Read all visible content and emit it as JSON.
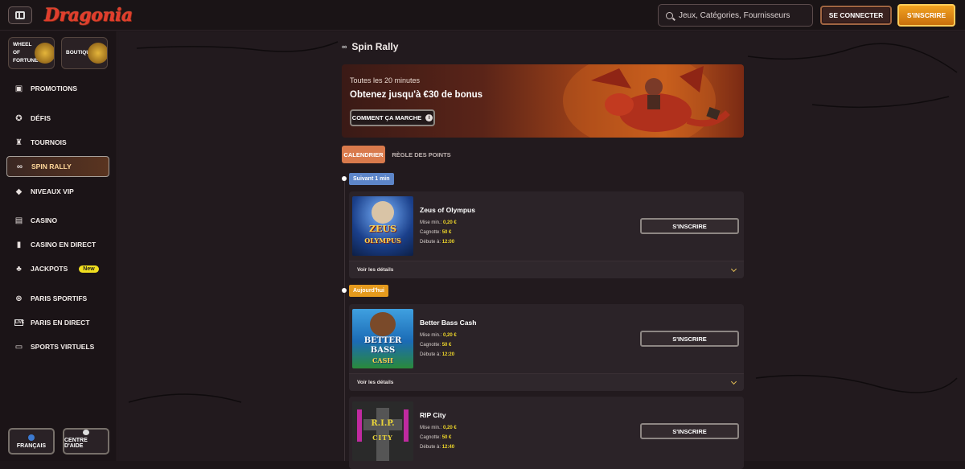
{
  "header": {
    "logo": "Dragonia",
    "search_placeholder": "Jeux, Catégories, Fournisseurs",
    "login_label": "SE CONNECTER",
    "signup_label": "S'INSCRIRE"
  },
  "sidebar": {
    "tiles": [
      {
        "label": "WHEEL OF FORTUNE"
      },
      {
        "label": "BOUTIQUE"
      }
    ],
    "items": [
      {
        "label": "PROMOTIONS",
        "icon": "gift-icon"
      },
      {
        "label": "DÉFIS",
        "icon": "medal-icon"
      },
      {
        "label": "TOURNOIS",
        "icon": "trophy-icon"
      },
      {
        "label": "SPIN RALLY",
        "icon": "rally-icon"
      },
      {
        "label": "NIVEAUX VIP",
        "icon": "diamond-icon"
      },
      {
        "label": "CASINO",
        "icon": "slot-icon"
      },
      {
        "label": "CASINO EN DIRECT",
        "icon": "cards-icon"
      },
      {
        "label": "JACKPOTS",
        "icon": "clover-icon",
        "badge": "New"
      },
      {
        "label": "PARIS SPORTIFS",
        "icon": "ball-icon"
      },
      {
        "label": "PARIS EN DIRECT",
        "icon": "live-icon"
      },
      {
        "label": "SPORTS VIRTUELS",
        "icon": "screen-icon"
      }
    ],
    "footer": {
      "language": "FRANÇAIS",
      "help": "CENTRE D'AIDE"
    }
  },
  "main": {
    "title": "Spin Rally",
    "hero": {
      "subtitle": "Toutes les 20 minutes",
      "title": "Obtenez jusqu'à €30 de bonus",
      "button": "COMMENT ÇA MARCHE"
    },
    "tabs": [
      {
        "label": "CALENDRIER",
        "active": true
      },
      {
        "label": "RÈGLE DES POINTS",
        "active": false
      }
    ],
    "sections": [
      {
        "tag": "Suivant 1 min"
      },
      {
        "tag": "Aujourd'hui"
      }
    ],
    "cards": [
      {
        "name": "Zeus of Olympus",
        "min_bet_label": "Mise min.:",
        "min_bet": "0,20 €",
        "pot_label": "Cagnotte:",
        "pot": "50 €",
        "start_label": "Débute à:",
        "start": "12:00",
        "button": "S'INSCRIRE",
        "details": "Voir les détails"
      },
      {
        "name": "Better Bass Cash",
        "min_bet_label": "Mise min.:",
        "min_bet": "0,20 €",
        "pot_label": "Cagnotte:",
        "pot": "50 €",
        "start_label": "Débute à:",
        "start": "12:20",
        "button": "S'INSCRIRE",
        "details": "Voir les détails"
      },
      {
        "name": "RIP City",
        "min_bet_label": "Mise min.:",
        "min_bet": "0,20 €",
        "pot_label": "Cagnotte:",
        "pot": "50 €",
        "start_label": "Débute à:",
        "start": "12:40",
        "button": "S'INSCRIRE"
      }
    ],
    "thumbs": {
      "zeus": [
        "ZEUS",
        "OLYMPUS"
      ],
      "bass": [
        "BETTER",
        "BASS",
        "CASH"
      ],
      "rip": [
        "R.I.P.",
        "CITY"
      ]
    }
  }
}
